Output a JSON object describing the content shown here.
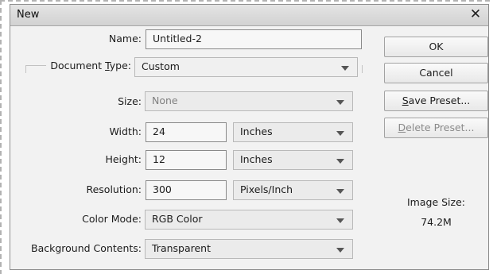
{
  "window": {
    "title": "New",
    "close_glyph": "✕"
  },
  "form": {
    "name": {
      "label": "Name:",
      "value": "Untitled-2"
    },
    "document_type": {
      "label_pre": "Document ",
      "label_u": "T",
      "label_post": "ype:",
      "value": "Custom"
    },
    "size": {
      "label": "Size:",
      "value": "None"
    },
    "width": {
      "label": "Width:",
      "value": "24",
      "unit": "Inches"
    },
    "height": {
      "label": "Height:",
      "value": "12",
      "unit": "Inches"
    },
    "resolution": {
      "label": "Resolution:",
      "value": "300",
      "unit": "Pixels/Inch"
    },
    "color_mode": {
      "label": "Color Mode:",
      "value": "RGB Color"
    },
    "background": {
      "label": "Background Contents:",
      "value": "Transparent"
    }
  },
  "buttons": {
    "ok": "OK",
    "cancel": "Cancel",
    "save_preset": {
      "u": "S",
      "rest": "ave Preset..."
    },
    "delete_preset": {
      "u": "D",
      "rest": "elete Preset..."
    }
  },
  "image_size": {
    "label": "Image Size:",
    "value": "74.2M"
  },
  "icons": {
    "close": "close-icon",
    "dropdown": "chevron-down-icon"
  }
}
